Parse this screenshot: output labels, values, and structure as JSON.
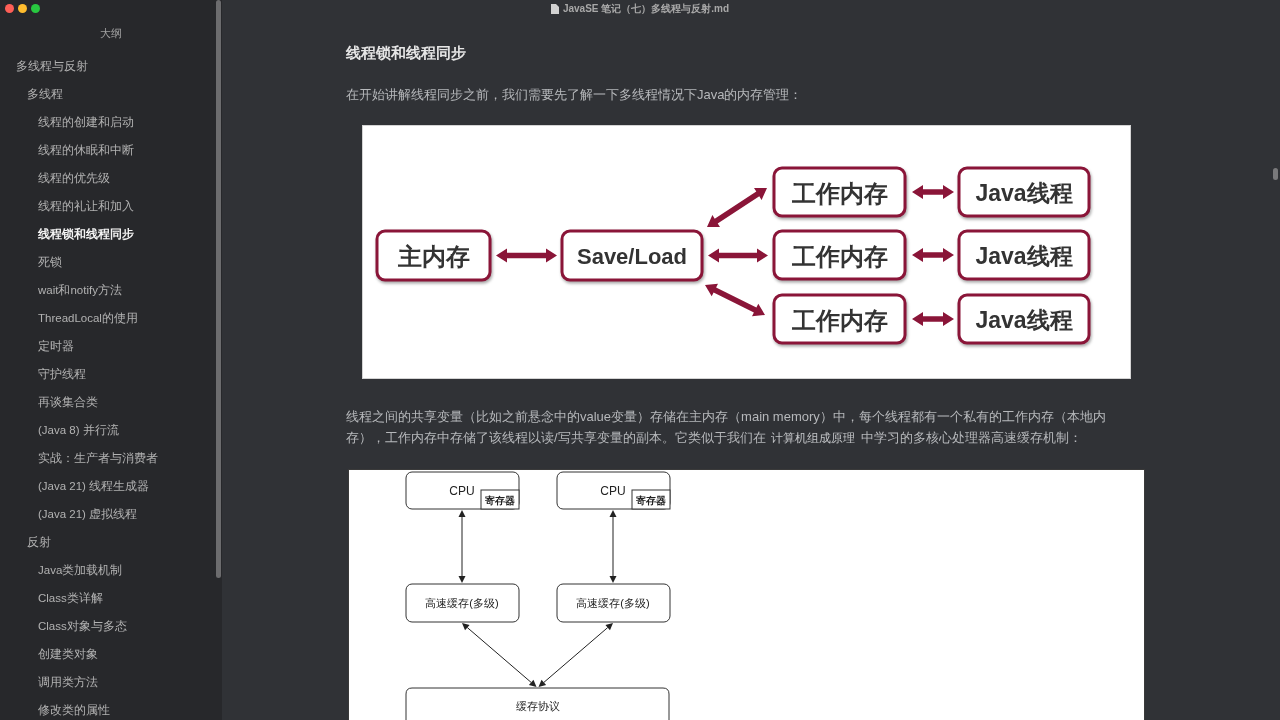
{
  "window": {
    "title": "JavaSE 笔记（七）多线程与反射.md"
  },
  "sidebar": {
    "title": "大纲",
    "outline": [
      {
        "label": "多线程与反射",
        "selected": false,
        "children": [
          {
            "label": "多线程",
            "selected": false,
            "children": [
              {
                "label": "线程的创建和启动",
                "selected": false
              },
              {
                "label": "线程的休眠和中断",
                "selected": false
              },
              {
                "label": "线程的优先级",
                "selected": false
              },
              {
                "label": "线程的礼让和加入",
                "selected": false
              },
              {
                "label": "线程锁和线程同步",
                "selected": true
              },
              {
                "label": "死锁",
                "selected": false
              },
              {
                "label": "wait和notify方法",
                "selected": false
              },
              {
                "label": "ThreadLocal的使用",
                "selected": false
              },
              {
                "label": "定时器",
                "selected": false
              },
              {
                "label": "守护线程",
                "selected": false
              },
              {
                "label": "再谈集合类",
                "selected": false
              },
              {
                "label": "(Java 8) 并行流",
                "selected": false
              },
              {
                "label": "实战：生产者与消费者",
                "selected": false
              },
              {
                "label": "(Java 21) 线程生成器",
                "selected": false
              },
              {
                "label": "(Java 21) 虚拟线程",
                "selected": false
              }
            ]
          },
          {
            "label": "反射",
            "selected": false,
            "children": [
              {
                "label": "Java类加载机制",
                "selected": false
              },
              {
                "label": "Class类详解",
                "selected": false
              },
              {
                "label": "Class对象与多态",
                "selected": false
              },
              {
                "label": "创建类对象",
                "selected": false
              },
              {
                "label": "调用类方法",
                "selected": false
              },
              {
                "label": "修改类的属性",
                "selected": false
              }
            ]
          }
        ]
      }
    ]
  },
  "document": {
    "blocks": [
      {
        "kind": "heading",
        "text": "线程锁和线程同步"
      },
      {
        "kind": "paragraph",
        "segments": [
          {
            "kind": "text",
            "text": "在开始讲解线程同步之前，我们需要先了解一下多线程情况下Java的内存管理："
          }
        ]
      },
      {
        "kind": "memory_diagram",
        "main_memory": "主内存",
        "save_load": "Save/Load",
        "work_memories": [
          "工作内存",
          "工作内存",
          "工作内存"
        ],
        "threads": [
          "Java线程",
          "Java线程",
          "Java线程"
        ]
      },
      {
        "kind": "paragraph",
        "segments": [
          {
            "kind": "text",
            "text": "线程之间的共享变量（比如之前悬念中的value变量）存储在主内存（main memory）中，每个线程都有一个私有的工作内存（本地内存），工作内存中存储了该线程以读/写共享变量的副本。它类似于我们在 "
          },
          {
            "kind": "code",
            "text": "计算机组成原理"
          },
          {
            "kind": "text",
            "text": " 中学习的多核心处理器高速缓存机制："
          }
        ]
      },
      {
        "kind": "cache_diagram",
        "cpus": [
          {
            "label": "CPU",
            "register": "寄存器"
          },
          {
            "label": "CPU",
            "register": "寄存器"
          }
        ],
        "caches": [
          "高速缓存(多级)",
          "高速缓存(多级)"
        ],
        "protocol": "缓存协议"
      }
    ]
  }
}
